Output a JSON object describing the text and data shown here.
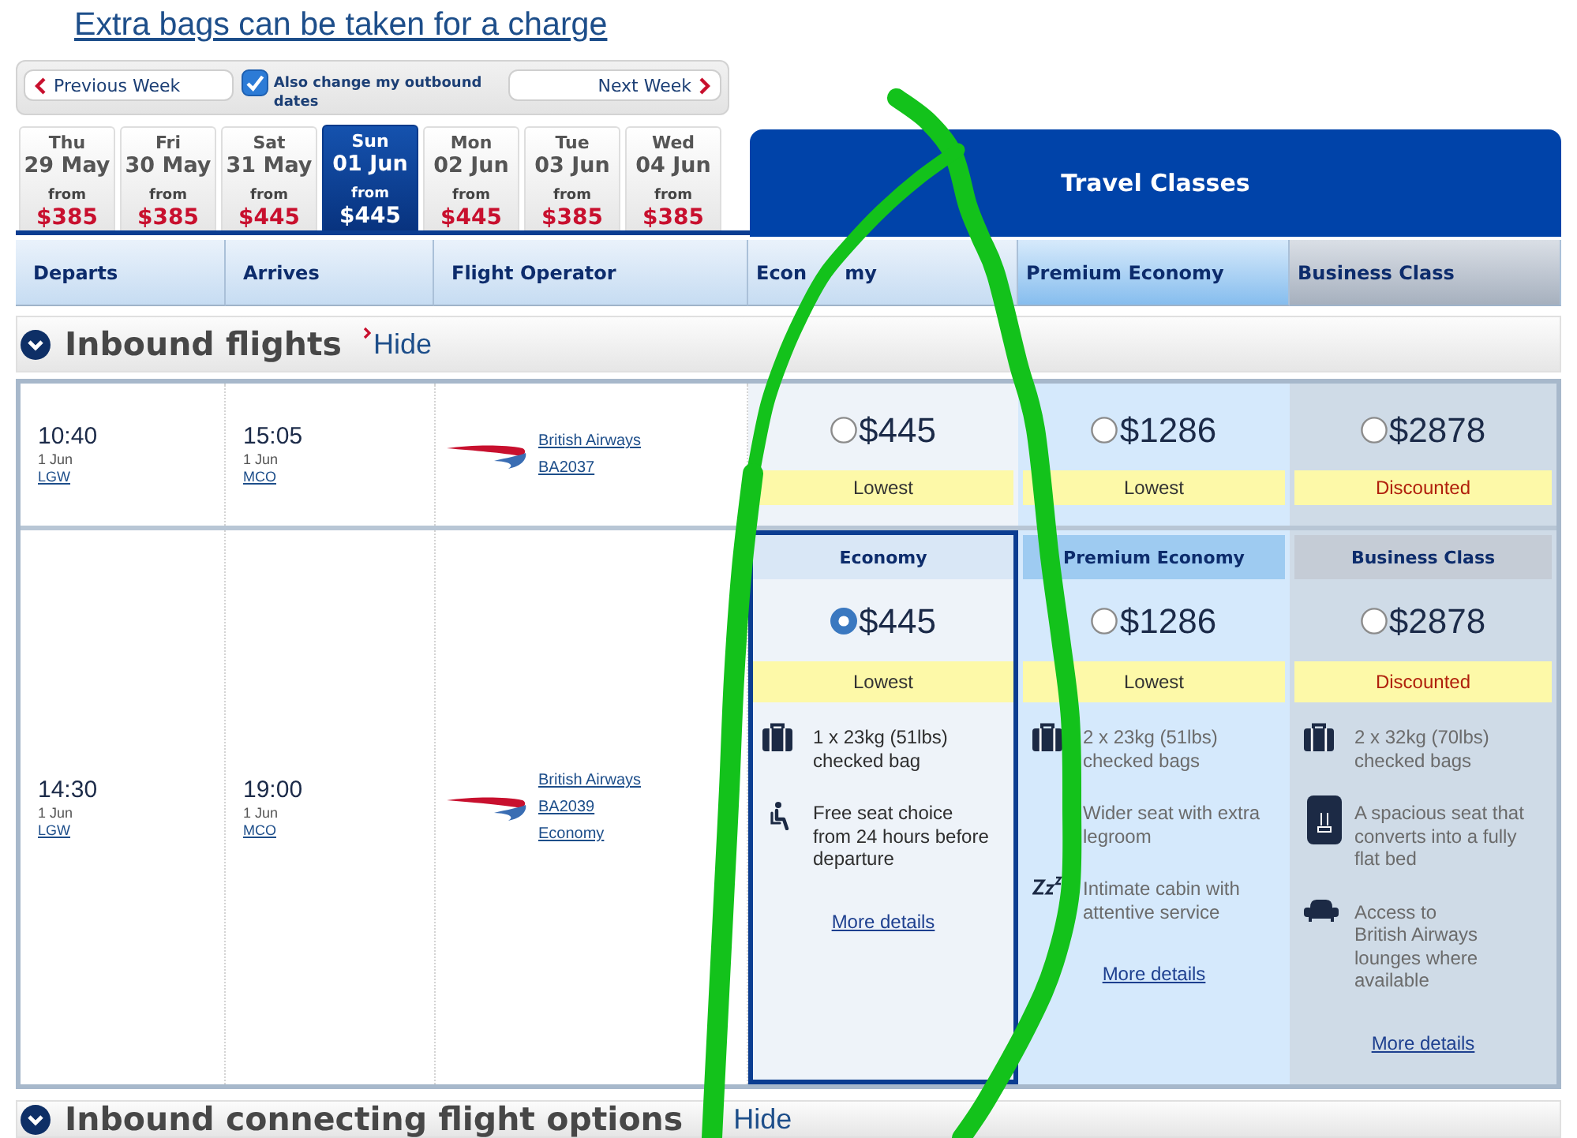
{
  "baggage_link": "Extra bags can be taken for a charge",
  "week_nav": {
    "previous": "Previous Week",
    "change_outbound": {
      "label": "Also change my outbound dates",
      "checked": true
    },
    "next": "Next Week"
  },
  "date_tabs": [
    {
      "day": "Thu",
      "date": "29 May",
      "from": "from",
      "price": "$385",
      "selected": false
    },
    {
      "day": "Fri",
      "date": "30 May",
      "from": "from",
      "price": "$385",
      "selected": false
    },
    {
      "day": "Sat",
      "date": "31 May",
      "from": "from",
      "price": "$445",
      "selected": false
    },
    {
      "day": "Sun",
      "date": "01 Jun",
      "from": "from",
      "price": "$445",
      "selected": true
    },
    {
      "day": "Mon",
      "date": "02 Jun",
      "from": "from",
      "price": "$445",
      "selected": false
    },
    {
      "day": "Tue",
      "date": "03 Jun",
      "from": "from",
      "price": "$385",
      "selected": false
    },
    {
      "day": "Wed",
      "date": "04 Jun",
      "from": "from",
      "price": "$385",
      "selected": false
    }
  ],
  "travel_classes": {
    "title": "Travel Classes"
  },
  "columns": [
    {
      "label": "Departs",
      "kind": "flight"
    },
    {
      "label": "Arrives",
      "kind": "flight"
    },
    {
      "label": "Flight Operator",
      "kind": "flight"
    },
    {
      "label": "Econ",
      "label_tail": "my",
      "kind": "economy"
    },
    {
      "label": "Premium Economy",
      "kind": "premium"
    },
    {
      "label": "Business Class",
      "kind": "business"
    }
  ],
  "section": {
    "title": "Inbound flights",
    "toggle": "Hide",
    "expanded": true
  },
  "flights": [
    {
      "departs": {
        "time": "10:40",
        "date": "1 Jun",
        "airport": "LGW"
      },
      "arrives": {
        "time": "15:05",
        "date": "1 Jun",
        "airport": "MCO"
      },
      "operator": [
        "British Airways",
        "BA2037"
      ],
      "expanded": false,
      "fares": [
        {
          "price": "$445",
          "selected": false,
          "tag": {
            "text": "Lowest",
            "kind": "lowest"
          }
        },
        {
          "price": "$1286",
          "selected": false,
          "tag": {
            "text": "Lowest",
            "kind": "lowest"
          }
        },
        {
          "price": "$2878",
          "selected": false,
          "tag": {
            "text": "Discounted",
            "kind": "discounted"
          }
        }
      ]
    },
    {
      "departs": {
        "time": "14:30",
        "date": "1 Jun",
        "airport": "LGW"
      },
      "arrives": {
        "time": "19:00",
        "date": "1 Jun",
        "airport": "MCO"
      },
      "operator": [
        "British Airways",
        "BA2039",
        "Economy"
      ],
      "expanded": true,
      "fares": [
        {
          "class": "Economy",
          "price": "$445",
          "selected": true,
          "tag": {
            "text": "Lowest",
            "kind": "lowest"
          },
          "features": [
            {
              "kind": "bag",
              "text": "1 x 23kg (51lbs)\nchecked bag"
            },
            {
              "kind": "seat",
              "text": "Free seat choice\nfrom 24 hours before\ndeparture"
            }
          ],
          "more": "More details"
        },
        {
          "class": "Premium Economy",
          "price": "$1286",
          "selected": false,
          "tag": {
            "text": "Lowest",
            "kind": "lowest"
          },
          "features": [
            {
              "kind": "bag",
              "text": "2 x 23kg (51lbs)\nchecked bags"
            },
            {
              "kind": "text",
              "text": "Wider seat with extra\nlegroom"
            },
            {
              "kind": "sleep",
              "text": "Intimate cabin with\nattentive service"
            }
          ],
          "more": "More details"
        },
        {
          "class": "Business Class",
          "price": "$2878",
          "selected": false,
          "tag": {
            "text": "Discounted",
            "kind": "discounted"
          },
          "features": [
            {
              "kind": "bag",
              "text": "2 x 32kg (70lbs)\nchecked bags"
            },
            {
              "kind": "flatbed",
              "text": "A spacious seat that\nconverts into a fully\nflat bed"
            },
            {
              "kind": "lounge",
              "text": "Access to\nBritish Airways\nlounges where\navailable"
            }
          ],
          "more": "More details"
        }
      ]
    }
  ],
  "next_section": {
    "title": "Inbound connecting flight options",
    "toggle": "Hide",
    "expanded": true
  }
}
